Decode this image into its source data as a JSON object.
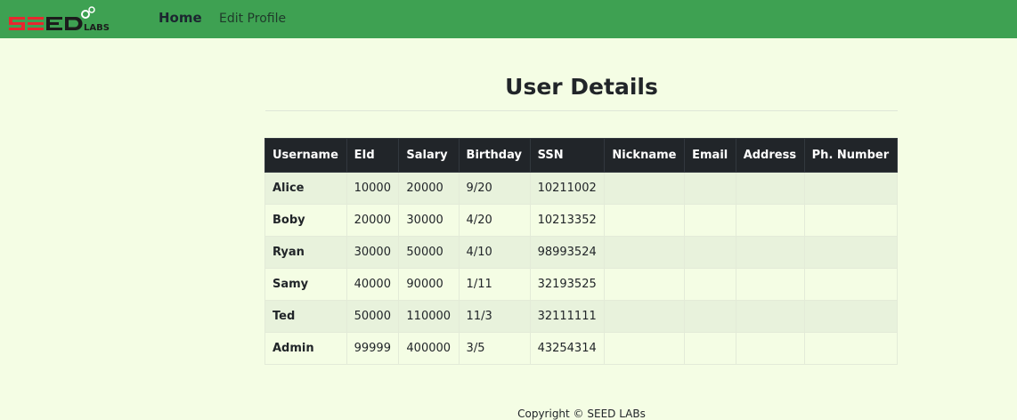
{
  "nav": {
    "brand": "SEEDLABS",
    "home_label": "Home",
    "edit_profile_label": "Edit Profile",
    "color": "#3ea152"
  },
  "page_title": "User Details",
  "table": {
    "headers": [
      "Username",
      "EId",
      "Salary",
      "Birthday",
      "SSN",
      "Nickname",
      "Email",
      "Address",
      "Ph. Number"
    ],
    "rows": [
      [
        "Alice",
        "10000",
        "20000",
        "9/20",
        "10211002",
        "",
        "",
        "",
        ""
      ],
      [
        "Boby",
        "20000",
        "30000",
        "4/20",
        "10213352",
        "",
        "",
        "",
        ""
      ],
      [
        "Ryan",
        "30000",
        "50000",
        "4/10",
        "98993524",
        "",
        "",
        "",
        ""
      ],
      [
        "Samy",
        "40000",
        "90000",
        "1/11",
        "32193525",
        "",
        "",
        "",
        ""
      ],
      [
        "Ted",
        "50000",
        "110000",
        "11/3",
        "32111111",
        "",
        "",
        "",
        ""
      ],
      [
        "Admin",
        "99999",
        "400000",
        "3/5",
        "43254314",
        "",
        "",
        "",
        ""
      ]
    ]
  },
  "footer": "Copyright © SEED LABs"
}
